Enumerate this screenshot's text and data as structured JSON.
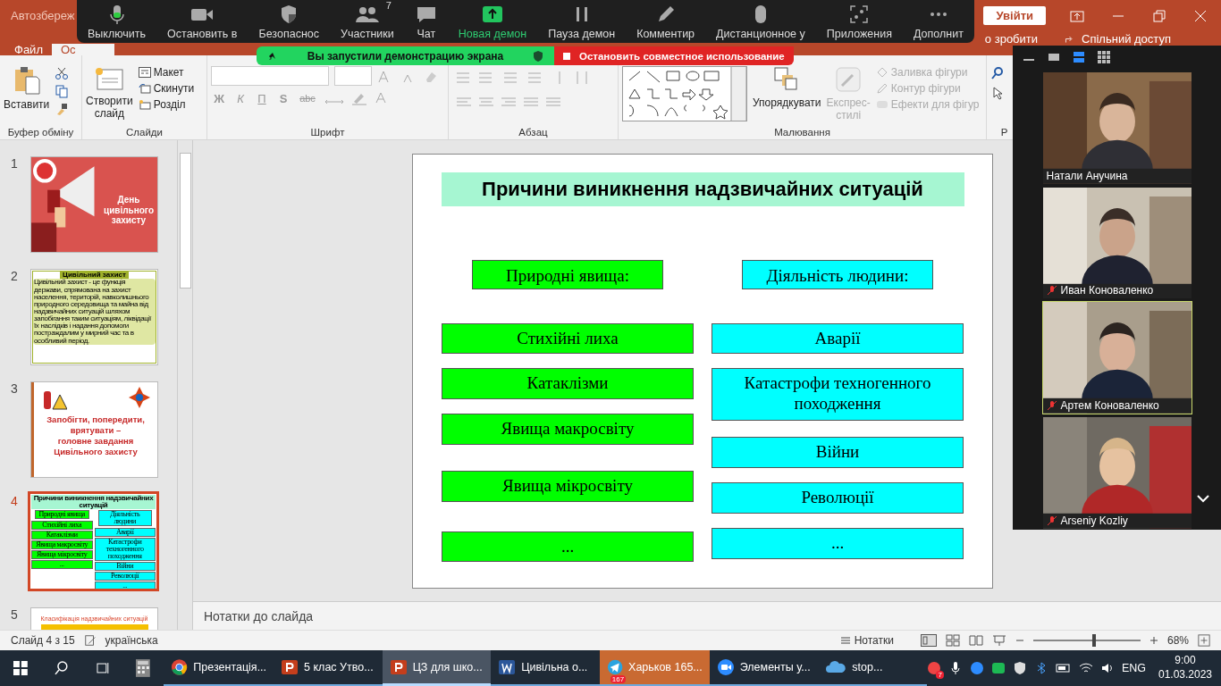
{
  "app": {
    "title": "Автозбереж",
    "signin": "Увійти",
    "tabs": [
      {
        "label": "Файл",
        "selected": false
      },
      {
        "label": "Ос",
        "selected": true
      }
    ],
    "tell_me": "о зробити",
    "share": "Спільний доступ"
  },
  "ribbon": {
    "clipboard": {
      "paste": "Вставити",
      "group": "Буфер обміну"
    },
    "slides": {
      "new_slide": [
        "Створити",
        "слайд"
      ],
      "layout": "Макет",
      "reset": "Скинути",
      "section": "Розділ",
      "group": "Слайди"
    },
    "font": {
      "bold": "Ж",
      "italic": "К",
      "underline": "П",
      "shadow": "S",
      "strike": "abc",
      "group": "Шрифт"
    },
    "paragraph": {
      "group": "Абзац"
    },
    "drawing": {
      "arrange": "Упорядкувати",
      "styles": [
        "Експрес-",
        "стилі"
      ],
      "fill": "Заливка фігури",
      "outline": "Контур фігури",
      "effects": "Ефекти для фігур",
      "group": "Малювання"
    },
    "editing": {
      "group": "Р"
    }
  },
  "slides": [
    {
      "number": "1",
      "selected": false,
      "kind": "megaphone",
      "texts": [
        "День",
        "цивільного",
        "захисту"
      ]
    },
    {
      "number": "2",
      "selected": false,
      "kind": "text",
      "texts": [
        "Цивільний захист",
        "Цивільний захист - це функція держави, спрямована на захист населення, територій, навколишнього природного середовища та майна від надзвичайних ситуацій шляхом запобігання таким ситуаціям, ліквідації їх наслідків і надання допомоги постраждалим у мирний час та в особливий період."
      ]
    },
    {
      "number": "3",
      "selected": false,
      "kind": "motto",
      "texts": [
        "Запобігти, попередити,",
        "врятувати –",
        "головне завдання",
        "Цивільного захисту"
      ]
    },
    {
      "number": "4",
      "selected": true,
      "kind": "diagram",
      "title": "Причини виникнення надзвичайних ситуацій",
      "columns": [
        {
          "header": "Природні явища",
          "items": [
            "Стихійні лиха",
            "Катаклізми",
            "Явища макросвіту",
            "Явища мікросвіту",
            "..."
          ]
        },
        {
          "header": "Діяльність людини",
          "items": [
            "Аварії",
            "Катастрофи техногенного походження",
            "Війни",
            "Революції",
            "..."
          ]
        }
      ]
    },
    {
      "number": "5",
      "selected": false,
      "kind": "heading",
      "texts": [
        "Класифікація надзвичайних ситуацій"
      ]
    }
  ],
  "slide": {
    "title": "Причини виникнення надзвичайних ситуацій",
    "columns": [
      {
        "color": "#00ff00",
        "header": "Природні явища:",
        "items": [
          {
            "text": "Стихійні лиха",
            "kind": "single"
          },
          {
            "text": "Катаклізми",
            "kind": "single"
          },
          {
            "text": "Явища макросвіту",
            "kind": "single"
          },
          {
            "text": "Явища мікросвіту",
            "kind": "spaced"
          },
          {
            "text": "...",
            "kind": "spaced"
          }
        ]
      },
      {
        "color": "#00ffff",
        "header": "Діяльність людини:",
        "items": [
          {
            "text": "Аварії",
            "kind": "single"
          },
          {
            "text": "Катастрофи техногенного походження",
            "kind": "double"
          },
          {
            "text": "Війни",
            "kind": "single"
          },
          {
            "text": "Революції",
            "kind": "single"
          },
          {
            "text": "...",
            "kind": "single"
          }
        ]
      }
    ]
  },
  "notes": "Нотатки до слайда",
  "status_bar": {
    "slide": "Слайд 4 з 15",
    "language": "українська",
    "notes": "Нотатки",
    "zoom": "68%",
    "level": 0.55
  },
  "zoom_toolbar": [
    {
      "label": "Выключить",
      "kind": "mic"
    },
    {
      "label": "Остановить в",
      "kind": "camera"
    },
    {
      "label": "Безопаснос",
      "kind": "shield"
    },
    {
      "label": "Участники",
      "kind": "people",
      "count": "7"
    },
    {
      "label": "Чат",
      "kind": "chat"
    },
    {
      "label": "Новая демон",
      "kind": "share"
    },
    {
      "label": "Пауза демон",
      "kind": "pause"
    },
    {
      "label": "Комментир",
      "kind": "pen"
    },
    {
      "label": "Дистанционное у",
      "kind": "mouse"
    },
    {
      "label": "Приложения",
      "kind": "apps"
    },
    {
      "label": "Дополнит",
      "kind": "more"
    }
  ],
  "share_banner": {
    "message": "Вы запустили демонстрацию экрана",
    "stop": "Остановить совместное использование"
  },
  "participants": [
    {
      "name": "Натали Анучина",
      "muted": false,
      "speaking": false
    },
    {
      "name": "Иван Коноваленко",
      "muted": true,
      "speaking": false
    },
    {
      "name": "Артем Коноваленко",
      "muted": true,
      "speaking": true
    },
    {
      "name": "Arseniy Kozliy",
      "muted": true,
      "speaking": false
    }
  ],
  "taskbar": {
    "apps": [
      {
        "label": "Презентація...",
        "kind": "chrome",
        "selected": false,
        "attention": false
      },
      {
        "label": "5 клас Утво...",
        "kind": "ppt",
        "selected": false,
        "attention": false
      },
      {
        "label": "ЦЗ для шко...",
        "kind": "ppt",
        "selected": true,
        "attention": false
      },
      {
        "label": "Цивільна о...",
        "kind": "word",
        "selected": false,
        "attention": false
      },
      {
        "label": "Харьков 165...",
        "kind": "telegram",
        "selected": false,
        "attention": true,
        "badge": "167"
      },
      {
        "label": "Элементы у...",
        "kind": "zoom",
        "selected": false,
        "attention": false
      },
      {
        "label": "stop...",
        "kind": "cloud",
        "selected": false,
        "attention": false
      }
    ],
    "tray_badge": "7",
    "language": "ENG",
    "time": "9:00",
    "date": "01.03.2023"
  }
}
